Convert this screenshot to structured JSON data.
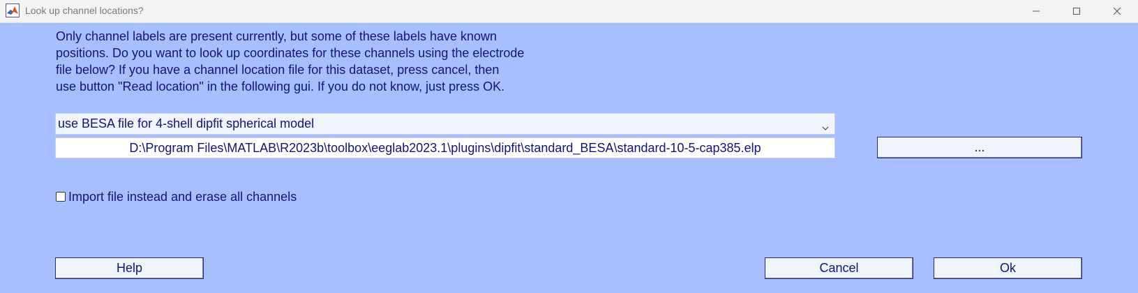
{
  "window": {
    "title": "Look up channel locations?"
  },
  "message": {
    "lines": [
      "Only channel labels are present currently, but some of these labels have known",
      "positions. Do you want to look up coordinates for these channels using the electrode",
      "file below? If you have a channel location file for this dataset, press cancel, then",
      "use button \"Read location\" in the following gui. If you do not know, just press OK."
    ]
  },
  "model_select": {
    "selected": "use BESA file for 4-shell dipfit spherical model"
  },
  "file_path": {
    "value": "D:\\Program Files\\MATLAB\\R2023b\\toolbox\\eeglab2023.1\\plugins\\dipfit\\standard_BESA\\standard-10-5-cap385.elp"
  },
  "browse_button": {
    "label": "..."
  },
  "import_checkbox": {
    "label": "Import file instead and erase all channels",
    "checked": false
  },
  "buttons": {
    "help": "Help",
    "cancel": "Cancel",
    "ok": "Ok"
  },
  "colors": {
    "background": "#a7bffe",
    "text": "#14137a",
    "titlebar": "#f3f3f3"
  },
  "icons": {
    "app": "matlab-icon",
    "minimize": "minimize-icon",
    "maximize": "maximize-icon",
    "close": "close-icon",
    "dropdown": "chevron-down-icon"
  }
}
